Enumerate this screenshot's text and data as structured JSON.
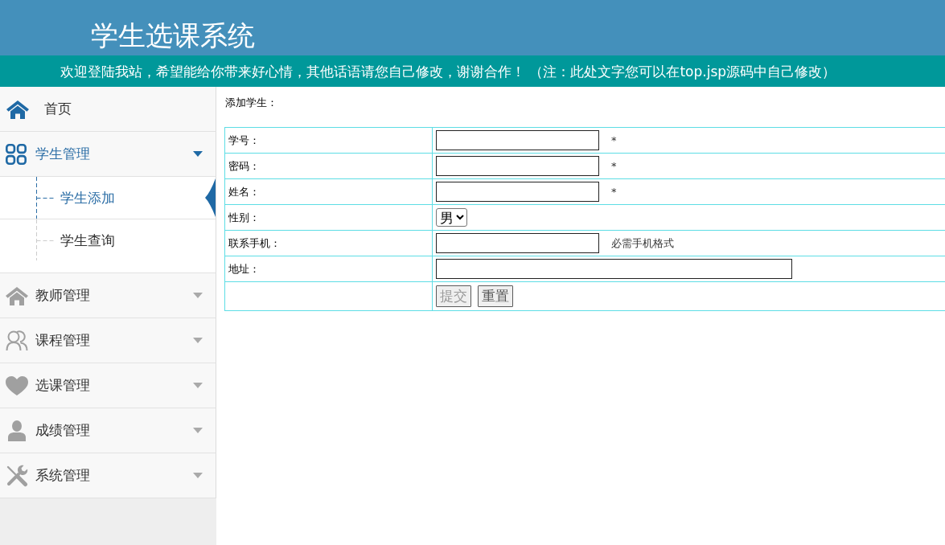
{
  "header": {
    "title": "学生选课系统",
    "notice": "欢迎登陆我站，希望能给你带来好心情，其他话语请您自己修改，谢谢合作！ （注：此处文字您可以在top.jsp源码中自己修改）"
  },
  "sidebar": {
    "items": [
      {
        "kind": "link",
        "label": "首页"
      },
      {
        "kind": "group",
        "label": "学生管理",
        "expanded": true,
        "children": [
          {
            "label": "学生添加",
            "selected": true
          },
          {
            "label": "学生查询",
            "selected": false
          }
        ]
      },
      {
        "kind": "group",
        "label": "教师管理",
        "expanded": false
      },
      {
        "kind": "group",
        "label": "课程管理",
        "expanded": false
      },
      {
        "kind": "group",
        "label": "选课管理",
        "expanded": false
      },
      {
        "kind": "group",
        "label": "成绩管理",
        "expanded": false
      },
      {
        "kind": "group",
        "label": "系统管理",
        "expanded": false
      }
    ]
  },
  "content": {
    "heading": "添加学生：",
    "form": {
      "rows": [
        {
          "kind": "field",
          "label": "学号：",
          "note": "*"
        },
        {
          "kind": "field",
          "label": "密码：",
          "note": "*"
        },
        {
          "kind": "field",
          "label": "姓名：",
          "note": "*"
        },
        {
          "kind": "select",
          "label": "性别：",
          "value": "男"
        },
        {
          "kind": "field",
          "label": "联系手机：",
          "note": "必需手机格式"
        },
        {
          "kind": "wide",
          "label": "地址："
        }
      ],
      "buttons": [
        {
          "label": "提交",
          "disabled": true
        },
        {
          "label": "重置",
          "disabled": false
        }
      ]
    }
  }
}
